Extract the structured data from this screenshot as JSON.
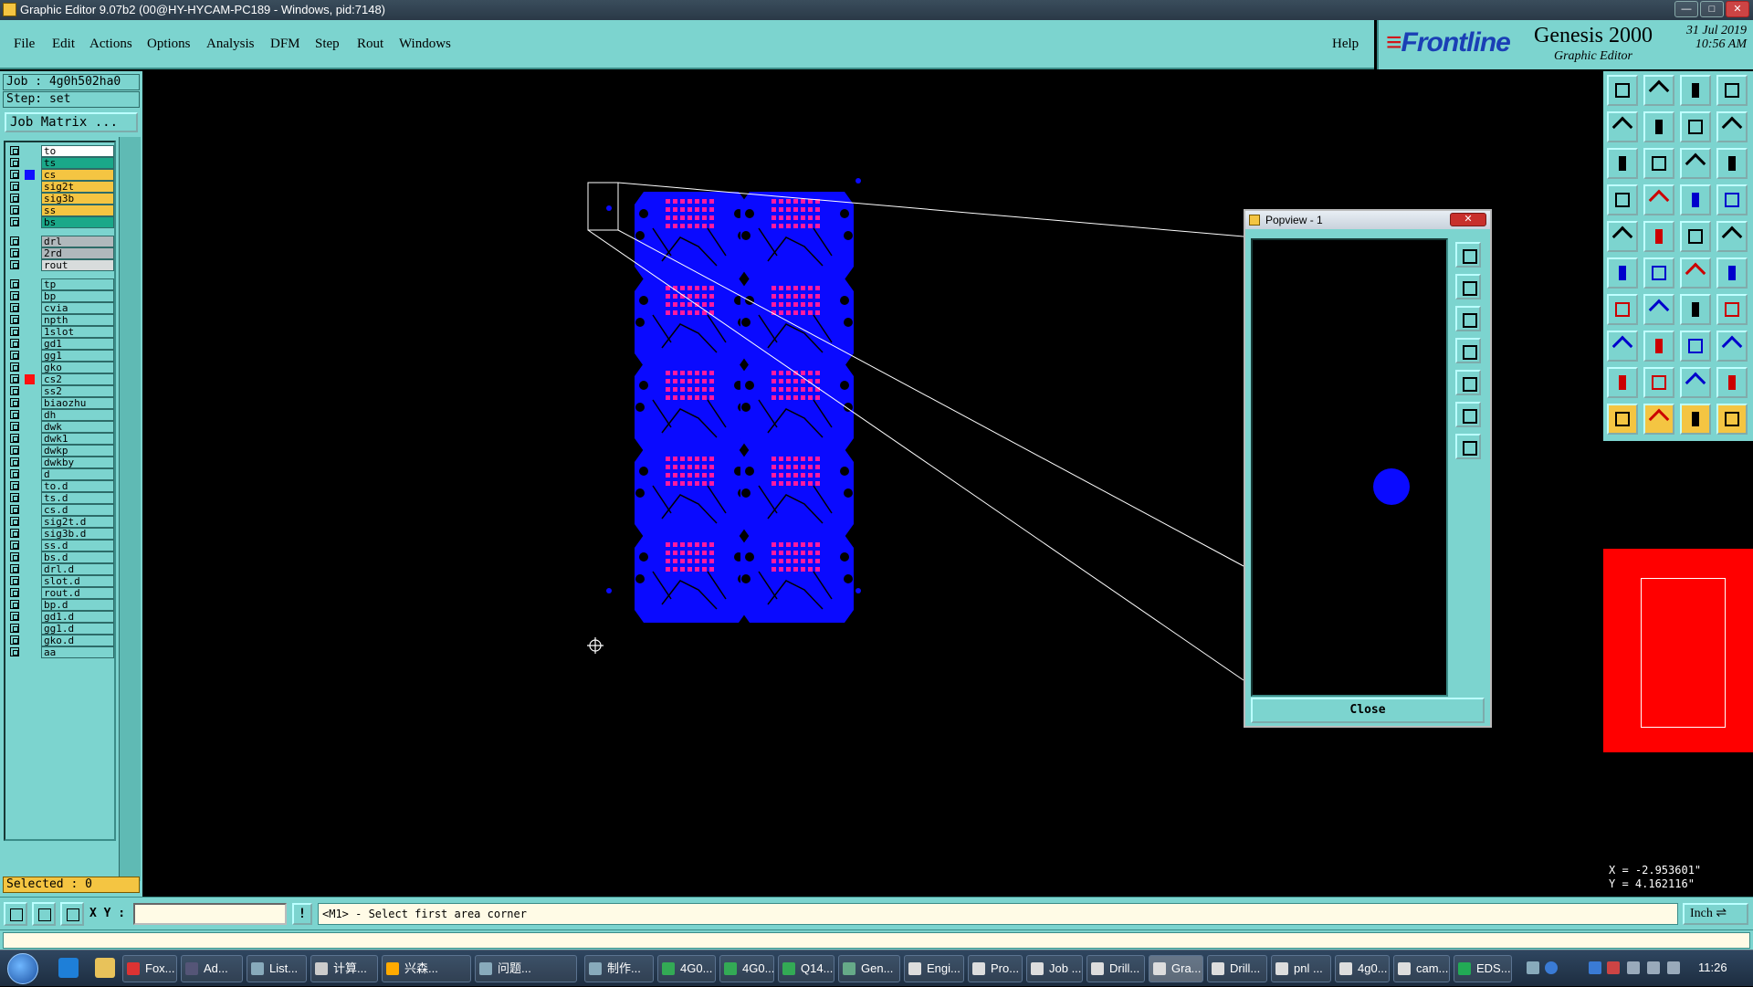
{
  "window": {
    "title": "Graphic Editor 9.07b2 (00@HY-HYCAM-PC189 - Windows, pid:7148)"
  },
  "menu": {
    "items": [
      "File",
      "Edit",
      "Actions",
      "Options",
      "Analysis",
      "DFM",
      "Step",
      "Rout",
      "Windows"
    ],
    "help": "Help"
  },
  "brand": {
    "logo": "Frontline",
    "product": "Genesis 2000",
    "subtitle": "Graphic Editor",
    "date": "31 Jul 2019",
    "time": "10:56 AM"
  },
  "job": {
    "job_label": "Job : 4g0h502ha0",
    "step_label": "Step: set",
    "job_matrix_button": "Job Matrix ..."
  },
  "layers": [
    {
      "name": "to",
      "color": "#ffffff",
      "marker": ""
    },
    {
      "name": "ts",
      "color": "#1aa889",
      "marker": ""
    },
    {
      "name": "cs",
      "color": "#f4c542",
      "marker": "#1010ff"
    },
    {
      "name": "sig2t",
      "color": "#f4c542",
      "marker": ""
    },
    {
      "name": "sig3b",
      "color": "#f4c542",
      "marker": ""
    },
    {
      "name": "ss",
      "color": "#f4c542",
      "marker": ""
    },
    {
      "name": "bs",
      "color": "#1aa889",
      "marker": ""
    },
    {
      "name": "drl",
      "color": "#b0b8bc",
      "marker": ""
    },
    {
      "name": "2rd",
      "color": "#b0b8bc",
      "marker": ""
    },
    {
      "name": "rout",
      "color": "#d8dcdc",
      "marker": ""
    },
    {
      "name": "tp",
      "color": "#7cd4cf",
      "marker": ""
    },
    {
      "name": "bp",
      "color": "#7cd4cf",
      "marker": ""
    },
    {
      "name": "cvia",
      "color": "#7cd4cf",
      "marker": ""
    },
    {
      "name": "npth",
      "color": "#7cd4cf",
      "marker": ""
    },
    {
      "name": "1slot",
      "color": "#7cd4cf",
      "marker": ""
    },
    {
      "name": "gd1",
      "color": "#7cd4cf",
      "marker": ""
    },
    {
      "name": "gg1",
      "color": "#7cd4cf",
      "marker": ""
    },
    {
      "name": "gko",
      "color": "#7cd4cf",
      "marker": ""
    },
    {
      "name": "cs2",
      "color": "#7cd4cf",
      "marker": "#ff1010"
    },
    {
      "name": "ss2",
      "color": "#7cd4cf",
      "marker": ""
    },
    {
      "name": "biaozhu",
      "color": "#7cd4cf",
      "marker": ""
    },
    {
      "name": "dh",
      "color": "#7cd4cf",
      "marker": ""
    },
    {
      "name": "dwk",
      "color": "#7cd4cf",
      "marker": ""
    },
    {
      "name": "dwk1",
      "color": "#7cd4cf",
      "marker": ""
    },
    {
      "name": "dwkp",
      "color": "#7cd4cf",
      "marker": ""
    },
    {
      "name": "dwkby",
      "color": "#7cd4cf",
      "marker": ""
    },
    {
      "name": "d",
      "color": "#7cd4cf",
      "marker": ""
    },
    {
      "name": "to.d",
      "color": "#7cd4cf",
      "marker": ""
    },
    {
      "name": "ts.d",
      "color": "#7cd4cf",
      "marker": ""
    },
    {
      "name": "cs.d",
      "color": "#7cd4cf",
      "marker": ""
    },
    {
      "name": "sig2t.d",
      "color": "#7cd4cf",
      "marker": ""
    },
    {
      "name": "sig3b.d",
      "color": "#7cd4cf",
      "marker": ""
    },
    {
      "name": "ss.d",
      "color": "#7cd4cf",
      "marker": ""
    },
    {
      "name": "bs.d",
      "color": "#7cd4cf",
      "marker": ""
    },
    {
      "name": "drl.d",
      "color": "#7cd4cf",
      "marker": ""
    },
    {
      "name": "slot.d",
      "color": "#7cd4cf",
      "marker": ""
    },
    {
      "name": "rout.d",
      "color": "#7cd4cf",
      "marker": ""
    },
    {
      "name": "bp.d",
      "color": "#7cd4cf",
      "marker": ""
    },
    {
      "name": "gd1.d",
      "color": "#7cd4cf",
      "marker": ""
    },
    {
      "name": "gg1.d",
      "color": "#7cd4cf",
      "marker": ""
    },
    {
      "name": "gko.d",
      "color": "#7cd4cf",
      "marker": ""
    },
    {
      "name": "aa",
      "color": "#7cd4cf",
      "marker": ""
    }
  ],
  "selected": "Selected : 0",
  "popview": {
    "title": "Popview - 1",
    "close_button": "Close"
  },
  "coords": {
    "x": "X = -2.953601\"",
    "y": "Y = 4.162116\""
  },
  "command": {
    "xy_label": "X Y :",
    "xy_value": "",
    "prompt": "<M1> - Select first area corner",
    "unit": "Inch"
  },
  "colors": {
    "panel": "#7cd4cf",
    "board": "#0a0aff",
    "pads": "#ff1aa0",
    "preview": "#ff0000"
  },
  "tools": [
    "open-icon",
    "save-icon",
    "home-icon",
    "window-icon",
    "step-in-icon",
    "step-out-icon",
    "layer-icon",
    "snap-icon",
    "zoom-fit-icon",
    "pan-icon",
    "scale-icon",
    "help-icon",
    "measure-icon",
    "drill-icon",
    "grid-icon",
    "split-icon",
    "select-icon",
    "clip-icon",
    "ruler-icon",
    "circle-icon",
    "node-icon",
    "cross-icon",
    "connect-icon",
    "move-icon",
    "line-icon",
    "arc-icon",
    "rotate-icon",
    "mirror-icon",
    "copy-icon",
    "delete-icon",
    "resize-icon",
    "feature-icon",
    "triangle-icon",
    "vertex-icon",
    "angle-icon",
    "polygon-icon",
    "pointer-icon",
    "pointer-area-icon",
    "pointer-net-icon",
    "pointer-route-icon"
  ],
  "taskbar": {
    "tasks": [
      "Fox...",
      "Ad...",
      "List...",
      "计算...",
      "兴森...",
      "问题...",
      "制作...",
      "4G0...",
      "4G0...",
      "Q14...",
      "Gen...",
      "Engi...",
      "Pro...",
      "Job ...",
      "Drill...",
      "Gra...",
      "Drill...",
      "pnl ...",
      "4g0...",
      "cam...",
      "EDS..."
    ],
    "active_index": 15,
    "clock": "11:26"
  }
}
